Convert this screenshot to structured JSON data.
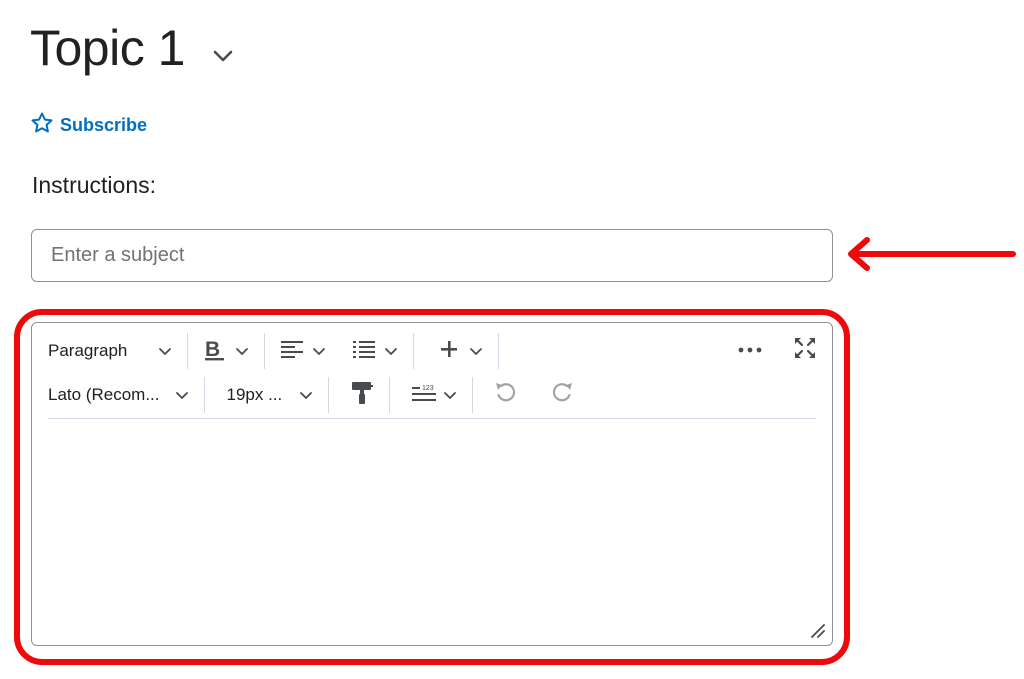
{
  "header": {
    "title": "Topic 1",
    "title_menu_icon": "chevron-down-icon"
  },
  "subscribe": {
    "label": "Subscribe",
    "icon": "star-outline-icon",
    "color": "#006fbf"
  },
  "instructions": {
    "label": "Instructions:"
  },
  "subject": {
    "value": "",
    "placeholder": "Enter a subject"
  },
  "editor": {
    "toolbar_row1": {
      "block_format": "Paragraph",
      "bold_icon": "bold-icon",
      "align_icon": "align-left-icon",
      "list_icon": "bullet-list-icon",
      "insert_icon": "plus-icon",
      "more_icon": "more-horizontal-icon",
      "fullscreen_icon": "fullscreen-icon"
    },
    "toolbar_row2": {
      "font_family": "Lato (Recom...",
      "font_size": "19px ...",
      "format_painter_icon": "format-painter-icon",
      "line_spacing_icon": "line-spacing-icon",
      "undo_icon": "undo-icon",
      "redo_icon": "redo-icon"
    },
    "content": "",
    "resize_icon": "resize-handle-icon"
  },
  "annotations": {
    "highlight_color": "#ee0a0a",
    "arrow_icon": "red-arrow-left-icon"
  }
}
